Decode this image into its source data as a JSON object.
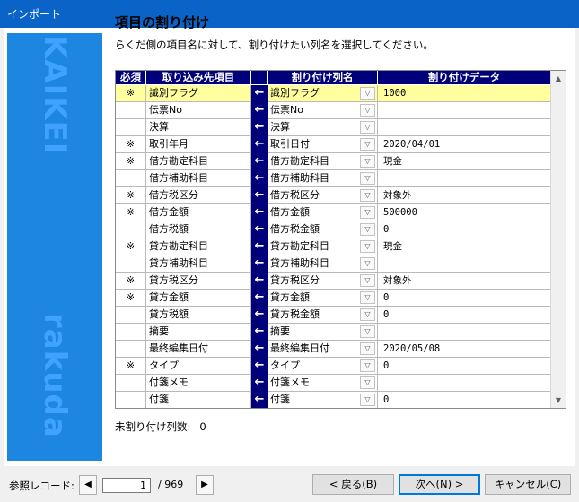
{
  "window": {
    "title": "インポート"
  },
  "sidebar": {
    "text_top": "KAIKEI",
    "text_bottom": "rakuda"
  },
  "heading": "項目の割り付け",
  "subheading": "らくだ側の項目名に対して、割り付けたい列名を選択してください。",
  "grid": {
    "headers": {
      "required": "必須",
      "dest": "取り込み先項目",
      "src": "割り付け列名",
      "data": "割り付けデータ"
    },
    "arrow": "←",
    "rows": [
      {
        "req": "※",
        "dest": "識別フラグ",
        "src": "識別フラグ",
        "data": "1000"
      },
      {
        "req": "",
        "dest": "伝票No",
        "src": "伝票No",
        "data": ""
      },
      {
        "req": "",
        "dest": "決算",
        "src": "決算",
        "data": ""
      },
      {
        "req": "※",
        "dest": "取引年月",
        "src": "取引日付",
        "data": "2020/04/01"
      },
      {
        "req": "※",
        "dest": "借方勘定科目",
        "src": "借方勘定科目",
        "data": "現金"
      },
      {
        "req": "",
        "dest": "借方補助科目",
        "src": "借方補助科目",
        "data": ""
      },
      {
        "req": "※",
        "dest": "借方税区分",
        "src": "借方税区分",
        "data": "対象外"
      },
      {
        "req": "※",
        "dest": "借方金額",
        "src": "借方金額",
        "data": "500000"
      },
      {
        "req": "",
        "dest": "借方税額",
        "src": "借方税金額",
        "data": "0"
      },
      {
        "req": "※",
        "dest": "貸方勘定科目",
        "src": "貸方勘定科目",
        "data": "現金"
      },
      {
        "req": "",
        "dest": "貸方補助科目",
        "src": "貸方補助科目",
        "data": ""
      },
      {
        "req": "※",
        "dest": "貸方税区分",
        "src": "貸方税区分",
        "data": "対象外"
      },
      {
        "req": "※",
        "dest": "貸方金額",
        "src": "貸方金額",
        "data": "0"
      },
      {
        "req": "",
        "dest": "貸方税額",
        "src": "貸方税金額",
        "data": "0"
      },
      {
        "req": "",
        "dest": "摘要",
        "src": "摘要",
        "data": ""
      },
      {
        "req": "",
        "dest": "最終編集日付",
        "src": "最終編集日付",
        "data": "2020/05/08"
      },
      {
        "req": "※",
        "dest": "タイプ",
        "src": "タイプ",
        "data": "0"
      },
      {
        "req": "",
        "dest": "付箋メモ",
        "src": "付箋メモ",
        "data": ""
      },
      {
        "req": "",
        "dest": "付箋",
        "src": "付箋",
        "data": "0"
      }
    ]
  },
  "unassigned": {
    "label": "未割り付け列数:",
    "count": "0"
  },
  "footer": {
    "record_label": "参照レコード:",
    "record_current": "1",
    "record_total": "/  969",
    "prev_icon": "◀",
    "next_icon": "▶",
    "back": "< 戻る(B)",
    "next": "次へ(N) >",
    "cancel": "キャンセル(C)"
  },
  "colors": {
    "titlebar": "#0a64c8",
    "sidebar": "#1d86e0",
    "header": "#00007a",
    "selected_row": "#ffff9e"
  }
}
